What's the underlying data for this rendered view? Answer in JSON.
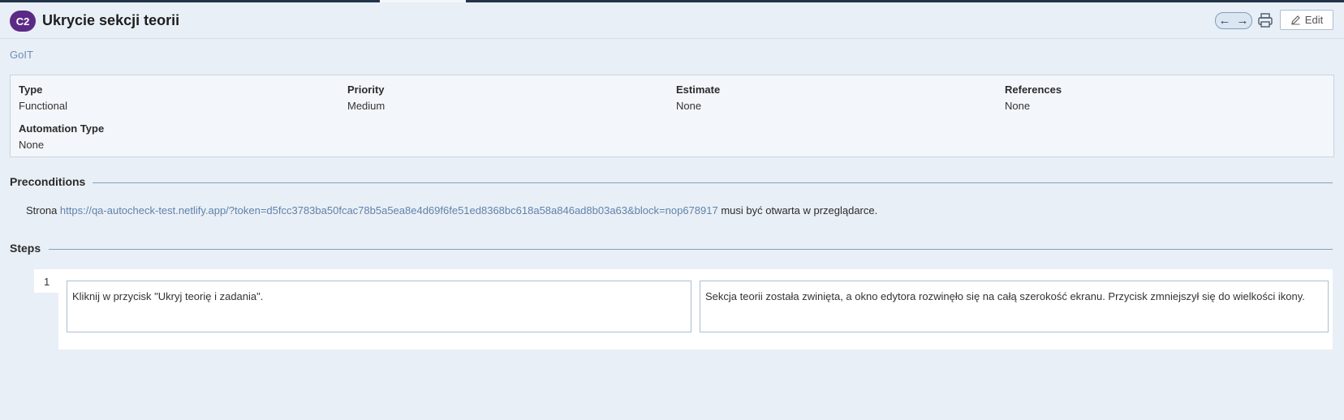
{
  "header": {
    "badge": "C2",
    "title": "Ukrycie sekcji teorii",
    "prev_icon": "arrow-left",
    "next_icon": "arrow-right",
    "print_icon": "printer",
    "edit_icon": "pencil",
    "edit_label": "Edit"
  },
  "project": "GoIT",
  "properties": [
    {
      "label": "Type",
      "value": "Functional"
    },
    {
      "label": "Priority",
      "value": "Medium"
    },
    {
      "label": "Estimate",
      "value": "None"
    },
    {
      "label": "References",
      "value": "None"
    },
    {
      "label": "Automation Type",
      "value": "None"
    }
  ],
  "preconditions": {
    "title": "Preconditions",
    "text_before": "Strona ",
    "link": "https://qa-autocheck-test.netlify.app/?token=d5fcc3783ba50fcac78b5a5ea8e4d69f6fe51ed8368bc618a58a846ad8b03a63&block=nop678917",
    "text_after": " musi być otwarta w przeglądarce."
  },
  "steps": {
    "title": "Steps",
    "items": [
      {
        "number": "1",
        "action": "Kliknij w przycisk \"Ukryj teorię i zadania\".",
        "expected": "Sekcja teorii została zwinięta, a okno edytora rozwinęło się na całą szerokość ekranu. Przycisk zmniejszył się do wielkości ikony."
      }
    ]
  },
  "colors": {
    "background": "#e9eff6",
    "badge": "#5b2a86",
    "link": "#5f83ab",
    "topbar": "#23344a"
  }
}
